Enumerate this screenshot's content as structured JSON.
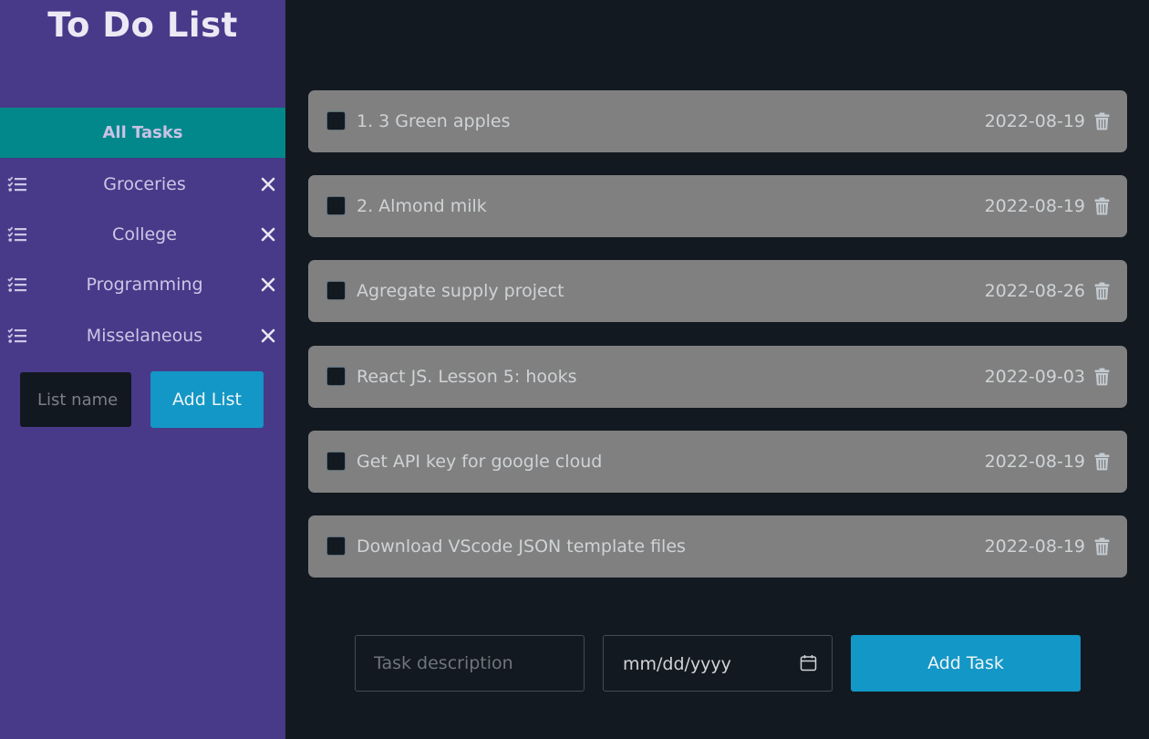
{
  "sidebar": {
    "title": "To Do List",
    "all_tasks_label": "All Tasks",
    "lists": [
      {
        "label": "Groceries",
        "icon": "list-check-icon",
        "remove_icon": "close-icon"
      },
      {
        "label": "College",
        "icon": "list-check-icon",
        "remove_icon": "close-icon"
      },
      {
        "label": "Programming",
        "icon": "list-check-icon",
        "remove_icon": "close-icon"
      },
      {
        "label": "Misselaneous",
        "icon": "list-check-icon",
        "remove_icon": "close-icon"
      }
    ],
    "new_list": {
      "placeholder": "List name",
      "value": ""
    },
    "add_list_label": "Add List"
  },
  "tasks": [
    {
      "text": "1. 3 Green apples",
      "date": "2022-08-19",
      "checked": false
    },
    {
      "text": "2. Almond milk",
      "date": "2022-08-19",
      "checked": false
    },
    {
      "text": "Agregate supply project",
      "date": "2022-08-26",
      "checked": false
    },
    {
      "text": "React JS. Lesson 5: hooks",
      "date": "2022-09-03",
      "checked": false
    },
    {
      "text": "Get API key for google cloud",
      "date": "2022-08-19",
      "checked": false
    },
    {
      "text": "Download VScode JSON template files",
      "date": "2022-08-19",
      "checked": false
    }
  ],
  "new_task": {
    "description_placeholder": "Task description",
    "description_value": "",
    "date_placeholder": "mm/dd/yyyy",
    "add_task_label": "Add Task"
  },
  "colors": {
    "sidebar_bg": "#483a89",
    "active_list_bg": "#02888a",
    "main_bg": "#131920",
    "task_bg": "#808080",
    "button_bg": "#1397c6"
  }
}
